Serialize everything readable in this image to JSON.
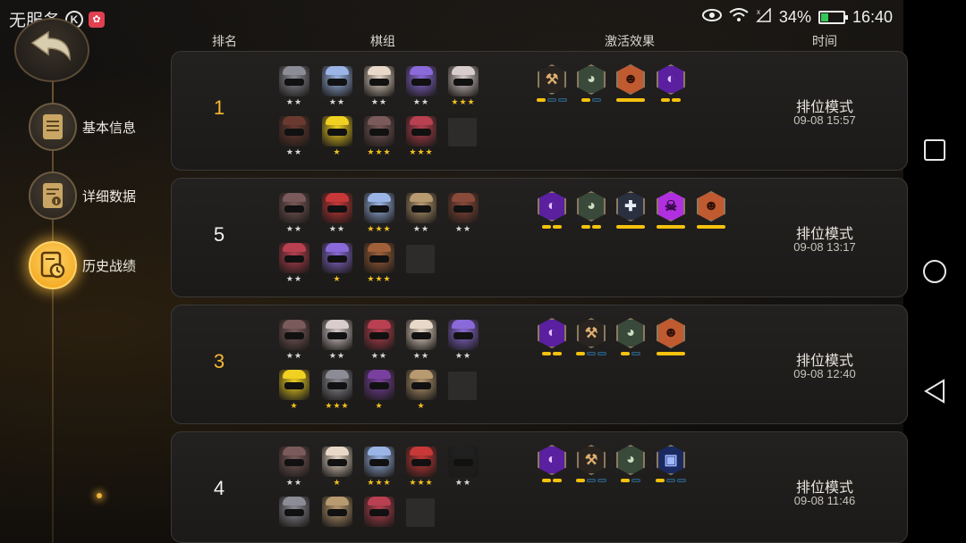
{
  "status_bar": {
    "carrier": "无服务",
    "k_badge": "K",
    "battery_text": "34%",
    "battery_level": 0.34,
    "time": "16:40",
    "icons": [
      "eye-icon",
      "wifi-icon",
      "signal-icon",
      "battery-icon"
    ]
  },
  "sidebar": {
    "back_icon": "back-arrow-icon",
    "items": [
      {
        "label": "基本信息",
        "icon": "document-icon",
        "active": false
      },
      {
        "label": "详细数据",
        "icon": "data-sheet-icon",
        "active": false
      },
      {
        "label": "历史战绩",
        "icon": "history-clock-icon",
        "active": true
      }
    ]
  },
  "table": {
    "headers": {
      "rank": "排名",
      "lineup": "棋组",
      "synergy": "激活效果",
      "time": "时间"
    }
  },
  "matches": [
    {
      "rank": "1",
      "gold": true,
      "mode": "排位模式",
      "time": "09-08 15:57",
      "pieces_top": [
        {
          "color": "#8c8c96",
          "stars": "★★",
          "gold": false
        },
        {
          "color": "#9ab4e6",
          "stars": "★★",
          "gold": false
        },
        {
          "color": "#e8d8c8",
          "stars": "★★",
          "gold": false
        },
        {
          "color": "#8a6ad8",
          "stars": "★★",
          "gold": false
        },
        {
          "color": "#d8cccc",
          "stars": "★★★",
          "gold": true
        }
      ],
      "pieces_bottom": [
        {
          "color": "#6a3a30",
          "stars": "★★",
          "gold": false
        },
        {
          "color": "#f0d020",
          "stars": "★",
          "gold": true
        },
        {
          "color": "#7a5a5a",
          "stars": "★★★",
          "gold": true
        },
        {
          "color": "#b84050",
          "stars": "★★★",
          "gold": true
        }
      ],
      "synergies": [
        {
          "icon": "axe-icon",
          "bg": "#2a2420",
          "fg": "#e0b070",
          "pips": [
            true,
            false,
            false
          ]
        },
        {
          "icon": "beast-icon",
          "bg": "#3a4a3a",
          "fg": "#c8e0c0",
          "pips": [
            true,
            false
          ]
        },
        {
          "icon": "demon-face-icon",
          "bg": "#c05a30",
          "fg": "#301008",
          "pips": [
            "wide"
          ]
        },
        {
          "icon": "mage-hood-icon",
          "bg": "#5a20a0",
          "fg": "#e0c0ff",
          "pips": [
            true,
            true
          ]
        }
      ]
    },
    {
      "rank": "5",
      "gold": false,
      "mode": "排位模式",
      "time": "09-08 13:17",
      "pieces_top": [
        {
          "color": "#7a5a5a",
          "stars": "★★",
          "gold": false
        },
        {
          "color": "#c83838",
          "stars": "★★",
          "gold": false
        },
        {
          "color": "#9ab4e6",
          "stars": "★★★",
          "gold": true
        },
        {
          "color": "#b89a70",
          "stars": "★★",
          "gold": false
        },
        {
          "color": "#8a4a3a",
          "stars": "★★",
          "gold": false
        }
      ],
      "pieces_bottom": [
        {
          "color": "#b84050",
          "stars": "★★",
          "gold": false
        },
        {
          "color": "#8a6ad8",
          "stars": "★",
          "gold": true
        },
        {
          "color": "#a0603a",
          "stars": "★★★",
          "gold": true
        }
      ],
      "synergies": [
        {
          "icon": "mage-hood-icon",
          "bg": "#5a20a0",
          "fg": "#e0c0ff",
          "pips": [
            true,
            true
          ]
        },
        {
          "icon": "beast-icon",
          "bg": "#3a4a3a",
          "fg": "#c8e0c0",
          "pips": [
            true,
            true
          ]
        },
        {
          "icon": "cross-shield-icon",
          "bg": "#2a3040",
          "fg": "#e8eef8",
          "pips": [
            "wide"
          ]
        },
        {
          "icon": "demon-skull-icon",
          "bg": "#b030e0",
          "fg": "#300840",
          "pips": [
            "wide"
          ]
        },
        {
          "icon": "demon-face-icon",
          "bg": "#c05a30",
          "fg": "#301008",
          "pips": [
            "wide"
          ]
        }
      ]
    },
    {
      "rank": "3",
      "gold": true,
      "mode": "排位模式",
      "time": "09-08 12:40",
      "pieces_top": [
        {
          "color": "#7a5a5a",
          "stars": "★★",
          "gold": false
        },
        {
          "color": "#d8cccc",
          "stars": "★★",
          "gold": false
        },
        {
          "color": "#b84050",
          "stars": "★★",
          "gold": false
        },
        {
          "color": "#e8d8c8",
          "stars": "★★",
          "gold": false
        },
        {
          "color": "#8a6ad8",
          "stars": "★★",
          "gold": false
        }
      ],
      "pieces_bottom": [
        {
          "color": "#f0d020",
          "stars": "★",
          "gold": true
        },
        {
          "color": "#8c8c96",
          "stars": "★★★",
          "gold": true
        },
        {
          "color": "#7a40a0",
          "stars": "★",
          "gold": true
        },
        {
          "color": "#b89a70",
          "stars": "★",
          "gold": true
        }
      ],
      "synergies": [
        {
          "icon": "mage-hood-icon",
          "bg": "#5a20a0",
          "fg": "#e0c0ff",
          "pips": [
            true,
            true
          ]
        },
        {
          "icon": "axe-icon",
          "bg": "#2a2420",
          "fg": "#e0b070",
          "pips": [
            true,
            false,
            false
          ]
        },
        {
          "icon": "beast-icon",
          "bg": "#3a4a3a",
          "fg": "#c8e0c0",
          "pips": [
            true,
            false
          ]
        },
        {
          "icon": "demon-face-icon",
          "bg": "#c05a30",
          "fg": "#301008",
          "pips": [
            "wide"
          ]
        }
      ]
    },
    {
      "rank": "4",
      "gold": false,
      "mode": "排位模式",
      "time": "09-08 11:46",
      "pieces_top": [
        {
          "color": "#7a5a5a",
          "stars": "★★",
          "gold": false
        },
        {
          "color": "#e8d8c8",
          "stars": "★",
          "gold": true
        },
        {
          "color": "#9ab4e6",
          "stars": "★★★",
          "gold": true
        },
        {
          "color": "#c83838",
          "stars": "★★★",
          "gold": true
        },
        {
          "color": "#202020",
          "stars": "★★",
          "gold": false
        }
      ],
      "pieces_bottom": [
        {
          "color": "#8c8c96",
          "stars": "",
          "gold": false
        },
        {
          "color": "#b89a70",
          "stars": "",
          "gold": false
        },
        {
          "color": "#b84050",
          "stars": "",
          "gold": false
        }
      ],
      "synergies": [
        {
          "icon": "mage-hood-icon",
          "bg": "#5a20a0",
          "fg": "#e0c0ff",
          "pips": [
            true,
            true
          ]
        },
        {
          "icon": "axe-icon",
          "bg": "#2a2420",
          "fg": "#e0b070",
          "pips": [
            true,
            false,
            false
          ]
        },
        {
          "icon": "beast-icon",
          "bg": "#3a4a3a",
          "fg": "#c8e0c0",
          "pips": [
            true,
            false
          ]
        },
        {
          "icon": "mech-icon",
          "bg": "#1a2a60",
          "fg": "#a0b8ff",
          "pips": [
            true,
            false,
            false
          ]
        }
      ]
    }
  ],
  "nav_bar": {
    "buttons": [
      "recent-apps-icon",
      "home-icon",
      "back-icon"
    ]
  }
}
